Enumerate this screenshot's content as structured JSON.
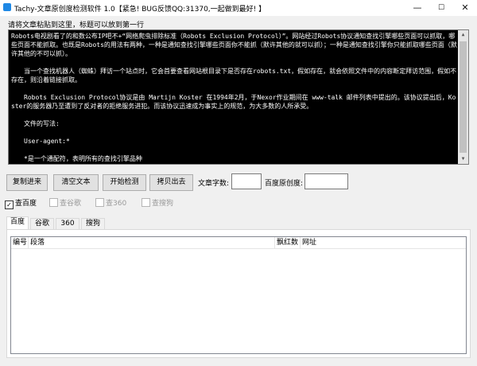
{
  "window": {
    "title": "Tachy-文章原创度检测软件 1.0【紧急! BUG反馈QQ:31370,一起做到最好! 】",
    "minimize": "—",
    "maximize": "☐",
    "close": "✕"
  },
  "hint": "请将文章粘贴到这里，标题可以放到第一行",
  "article": {
    "paragraphs": [
      "Robots电视剧看了的和数公布IP吧不+“网络爬虫排除标准（Robots Exclusion Protocol）”。网站经过Robots协议通知查找引擎哪些页面可以抓取，哪些页面不能抓取。也既是Robots的用法有两种，一种是通知查找引擎哪些页面你不能抓（默许其他的就可以抓）；一种是通知查找引擎你只能抓取哪些页面（默许其他的不可以抓）。",
      "当一个查找机器人（蜘蛛）拜访一个站点时，它会首要查看网站根目录下是否存在robots.txt，假如存在，就会依照文件中的内容断定拜访范围，假如不存在，则沿着链接抓取。",
      "Robots Exclusion Protocol协议是由 Martijn Koster 在1994年2月，于Nexor作业期间在 www-talk 邮件列表中提出的。该协议提出后，Koster的服务器乃至遭到了反对者的拒绝服务进犯。而该协议迅速成为事实上的规范，为大多数的人所承受。",
      "文件的写法:",
      "User-agent:*",
      "*是一个通配符，表明所有的查找引擎品种"
    ]
  },
  "buttons": {
    "paste": "复制进来",
    "clear": "清空文本",
    "start": "开始检测",
    "copy_out": "拷贝出去"
  },
  "fields": {
    "word_count_label": "文章字数:",
    "word_count_value": "",
    "baidu_originality_label": "百度原创度:",
    "baidu_originality_value": ""
  },
  "engines": [
    {
      "label": "查百度",
      "checked": true,
      "enabled": true
    },
    {
      "label": "查谷歌",
      "checked": false,
      "enabled": false
    },
    {
      "label": "查360",
      "checked": false,
      "enabled": false
    },
    {
      "label": "查搜狗",
      "checked": false,
      "enabled": false
    }
  ],
  "tabs": [
    "百度",
    "谷歌",
    "360",
    "搜狗"
  ],
  "active_tab": "百度",
  "table": {
    "columns": [
      "编号",
      "段落",
      "飘红数",
      "网址"
    ],
    "rows": []
  }
}
